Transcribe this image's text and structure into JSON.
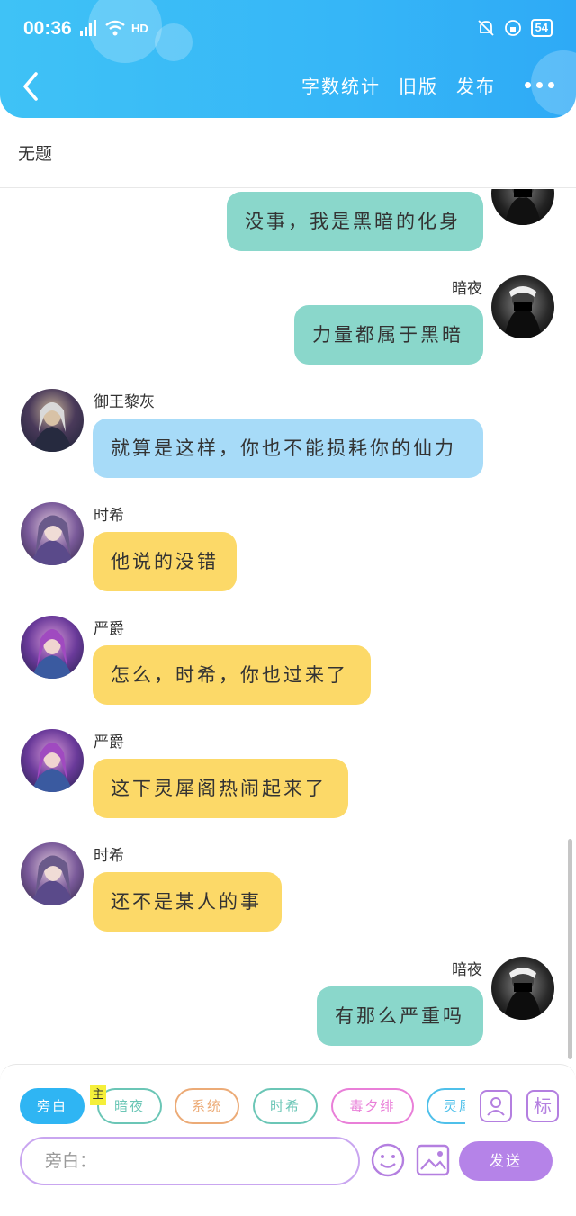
{
  "status_bar": {
    "time": "00:36",
    "network": "4G",
    "hd": "HD",
    "battery": "54"
  },
  "header": {
    "actions": {
      "word_count": "字数统计",
      "old_version": "旧版",
      "publish": "发布"
    }
  },
  "title": "无题",
  "messages": [
    {
      "side": "right",
      "speaker": "",
      "text": "没事，我是黑暗的化身",
      "bubble": "teal"
    },
    {
      "side": "right",
      "speaker": "暗夜",
      "text": "力量都属于黑暗",
      "bubble": "teal"
    },
    {
      "side": "left",
      "speaker": "御王黎灰",
      "text": "就算是这样，你也不能损耗你的仙力",
      "bubble": "blue"
    },
    {
      "side": "left",
      "speaker": "时希",
      "text": "他说的没错",
      "bubble": "yellow"
    },
    {
      "side": "left",
      "speaker": "严爵",
      "text": "怎么，时希，你也过来了",
      "bubble": "yellow"
    },
    {
      "side": "left",
      "speaker": "严爵",
      "text": "这下灵犀阁热闹起来了",
      "bubble": "yellow"
    },
    {
      "side": "left",
      "speaker": "时希",
      "text": "还不是某人的事",
      "bubble": "yellow"
    },
    {
      "side": "right",
      "speaker": "暗夜",
      "text": "有那么严重吗",
      "bubble": "teal"
    }
  ],
  "role_chips": [
    {
      "label": "旁白",
      "color": "#2fb5f3",
      "selected": true
    },
    {
      "label": "暗夜",
      "color": "#6bc6b6",
      "selected": false
    },
    {
      "label": "系统",
      "color": "#ecab77",
      "selected": false
    },
    {
      "label": "时希",
      "color": "#6bc6b6",
      "selected": false
    },
    {
      "label": "毒夕绯",
      "color": "#e97fd8",
      "selected": false
    },
    {
      "label": "灵犀",
      "color": "#4fc0ea",
      "selected": false
    }
  ],
  "main_badge": "主",
  "tools": {
    "mark_label": "标",
    "person_icon": "person-icon",
    "emoji_icon": "smile-icon",
    "image_icon": "image-icon"
  },
  "composer": {
    "placeholder": "旁白：",
    "send_label": "发送"
  },
  "colors": {
    "header_blue": "#36b6f7",
    "teal": "#8ad7cb",
    "blue": "#a7dbf8",
    "yellow": "#fcd968",
    "purple": "#b583e8"
  }
}
